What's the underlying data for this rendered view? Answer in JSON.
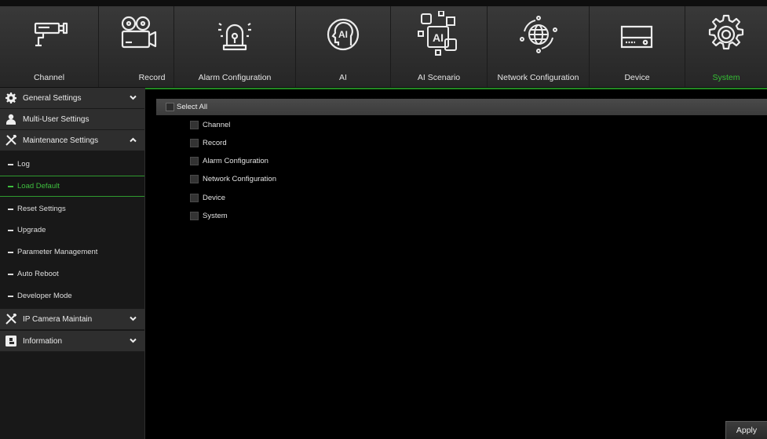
{
  "nav": {
    "items": [
      {
        "label": "Channel",
        "icon": "cctv-camera-icon"
      },
      {
        "label": "Record",
        "icon": "film-camera-icon"
      },
      {
        "label": "Alarm Configuration",
        "icon": "alarm-siren-icon"
      },
      {
        "label": "AI",
        "icon": "ai-head-icon"
      },
      {
        "label": "AI Scenario",
        "icon": "ai-scenario-icon"
      },
      {
        "label": "Network Configuration",
        "icon": "network-globe-icon"
      },
      {
        "label": "Device",
        "icon": "hard-drive-icon"
      },
      {
        "label": "System",
        "icon": "gear-icon"
      }
    ],
    "active": "System",
    "active_color": "#35c035"
  },
  "sidebar": {
    "general": {
      "label": "General Settings",
      "icon": "gear-icon"
    },
    "multiuser": {
      "label": "Multi-User Settings",
      "icon": "user-icon"
    },
    "maintenance": {
      "label": "Maintenance Settings",
      "icon": "tools-icon"
    },
    "maintenance_items": [
      "Log",
      "Load Default",
      "Reset Settings",
      "Upgrade",
      "Parameter Management",
      "Auto Reboot",
      "Developer Mode"
    ],
    "active_item": "Load Default",
    "ipcam": {
      "label": "IP Camera Maintain",
      "icon": "tools-icon"
    },
    "info": {
      "label": "Information",
      "icon": "info-icon"
    }
  },
  "main": {
    "select_all": "Select All",
    "options": [
      "Channel",
      "Record",
      "Alarm Configuration",
      "Network Configuration",
      "Device",
      "System"
    ]
  },
  "footer": {
    "apply_label": "Apply"
  }
}
